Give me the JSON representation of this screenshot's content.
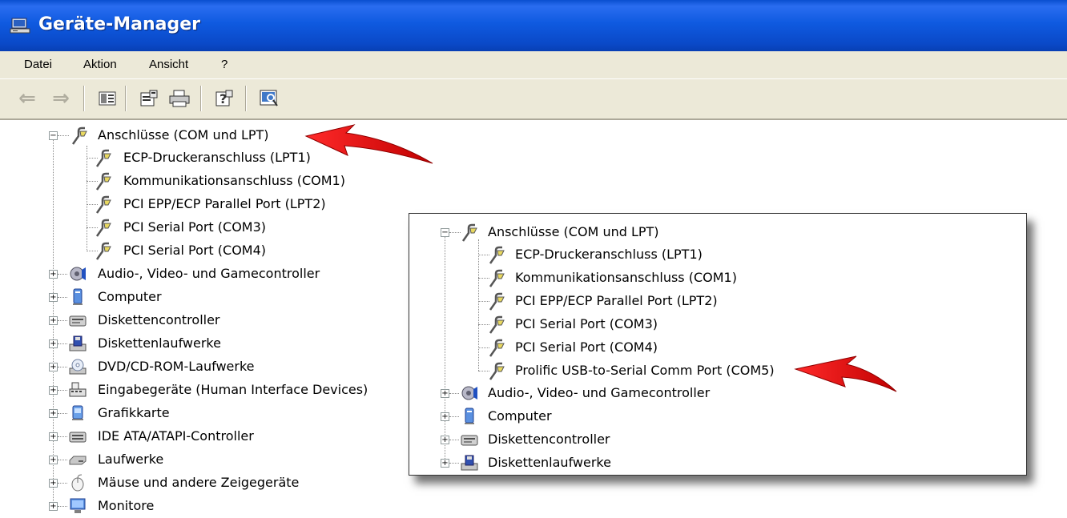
{
  "window": {
    "title": "Geräte-Manager",
    "icon": "computer-manager-icon"
  },
  "menu": {
    "items": [
      "Datei",
      "Aktion",
      "Ansicht",
      "?"
    ]
  },
  "toolbar": {
    "buttons": [
      "back-arrow-icon",
      "forward-arrow-icon",
      "show-hide-tree-icon",
      "properties-icon",
      "print-icon",
      "help-icon",
      "scan-hardware-icon"
    ]
  },
  "tree": {
    "group": {
      "label": "Anschlüsse (COM und LPT)",
      "expanded": true
    },
    "children": [
      "ECP-Druckeranschluss (LPT1)",
      "Kommunikationsanschluss (COM1)",
      "PCI EPP/ECP Parallel Port (LPT2)",
      "PCI Serial Port (COM3)",
      "PCI Serial Port (COM4)"
    ],
    "categories": [
      {
        "label": "Audio-, Video- und Gamecontroller",
        "icon": "audio-icon"
      },
      {
        "label": "Computer",
        "icon": "computer-icon"
      },
      {
        "label": "Diskettencontroller",
        "icon": "floppy-controller-icon"
      },
      {
        "label": "Diskettenlaufwerke",
        "icon": "floppy-drive-icon"
      },
      {
        "label": "DVD/CD-ROM-Laufwerke",
        "icon": "cdrom-icon"
      },
      {
        "label": "Eingabegeräte (Human Interface Devices)",
        "icon": "hid-icon"
      },
      {
        "label": "Grafikkarte",
        "icon": "display-adapter-icon"
      },
      {
        "label": "IDE ATA/ATAPI-Controller",
        "icon": "ide-controller-icon"
      },
      {
        "label": "Laufwerke",
        "icon": "disk-drive-icon"
      },
      {
        "label": "Mäuse und andere Zeigegeräte",
        "icon": "mouse-icon"
      },
      {
        "label": "Monitore",
        "icon": "monitor-icon"
      }
    ]
  },
  "inset": {
    "group": {
      "label": "Anschlüsse (COM und LPT)",
      "expanded": true
    },
    "children": [
      "ECP-Druckeranschluss (LPT1)",
      "Kommunikationsanschluss (COM1)",
      "PCI EPP/ECP Parallel Port (LPT2)",
      "PCI Serial Port (COM3)",
      "PCI Serial Port (COM4)",
      "Prolific USB-to-Serial Comm Port (COM5)"
    ],
    "categories": [
      {
        "label": "Audio-, Video- und Gamecontroller",
        "icon": "audio-icon"
      },
      {
        "label": "Computer",
        "icon": "computer-icon"
      },
      {
        "label": "Diskettencontroller",
        "icon": "floppy-controller-icon"
      },
      {
        "label": "Diskettenlaufwerke",
        "icon": "floppy-drive-icon"
      }
    ]
  },
  "colors": {
    "titlebar": "#0a49c8",
    "chrome": "#ece9d8",
    "arrow": "#e01010"
  }
}
